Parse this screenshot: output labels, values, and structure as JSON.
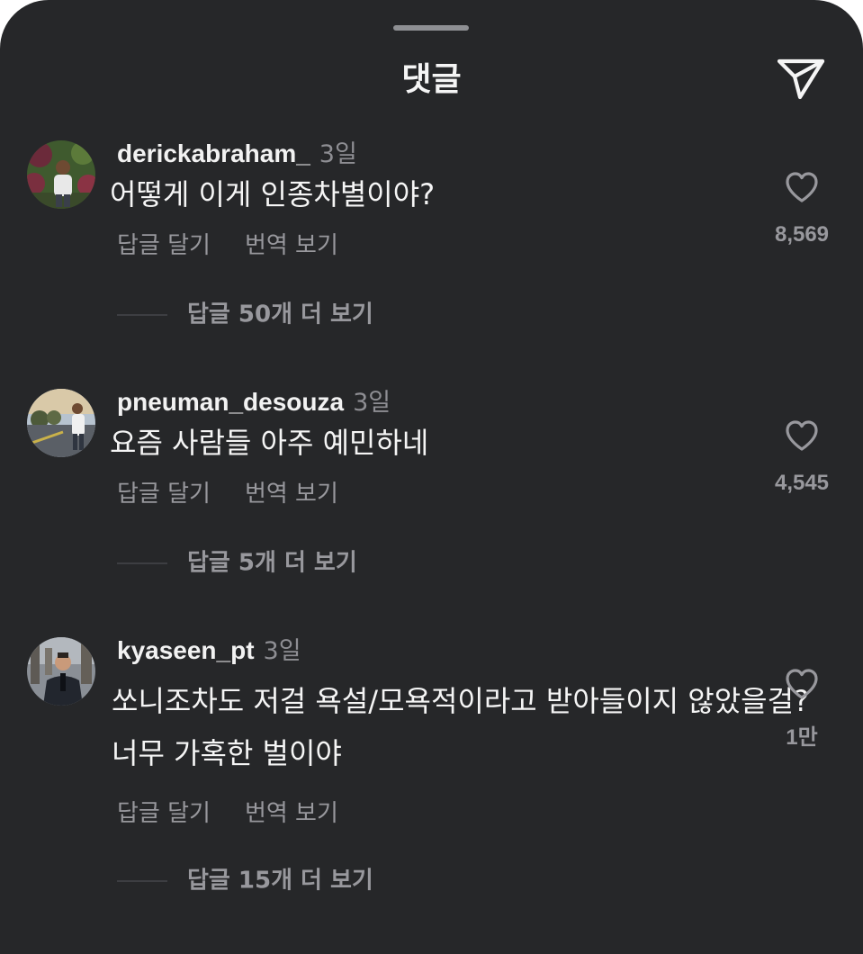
{
  "header": {
    "title": "댓글",
    "share_icon": "paper-plane-icon"
  },
  "comments": [
    {
      "username": "derickabraham_",
      "time": "3일",
      "lines": [
        "어떻게 이게 인종차별이야?"
      ],
      "reply_label": "답글 달기",
      "translate_label": "번역 보기",
      "more_replies": "답글 50개 더 보기",
      "likes": "8,569",
      "avatar_icon": "profile-photo"
    },
    {
      "username": "pneuman_desouza",
      "time": "3일",
      "lines": [
        "요즘 사람들 아주 예민하네"
      ],
      "reply_label": "답글 달기",
      "translate_label": "번역 보기",
      "more_replies": "답글 5개 더 보기",
      "likes": "4,545",
      "avatar_icon": "profile-photo"
    },
    {
      "username": "kyaseen_pt",
      "time": "3일",
      "lines": [
        "쏘니조차도 저걸 욕설/모욕적이라고 받아들이지 않았을걸?",
        "너무 가혹한 벌이야"
      ],
      "reply_label": "답글 달기",
      "translate_label": "번역 보기",
      "more_replies": "답글 15개 더 보기",
      "likes": "1만",
      "avatar_icon": "profile-photo"
    }
  ],
  "colors": {
    "background": "#262729",
    "primary_text": "#f5f5f5",
    "secondary_text": "#98989d"
  }
}
